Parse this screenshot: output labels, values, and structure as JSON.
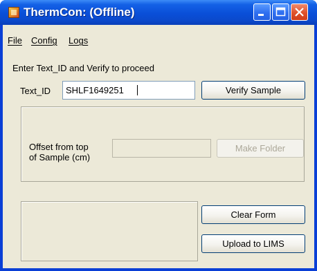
{
  "window": {
    "title": "ThermCon: (Offline)"
  },
  "menu": {
    "file": "File",
    "config": "Config",
    "logs": "Logs"
  },
  "form": {
    "instruction": "Enter Text_ID and Verify to proceed",
    "text_id_label": "Text_ID",
    "text_id_value": "SHLF1649251",
    "verify_button": "Verify Sample",
    "offset_label_line1": "Offset from top",
    "offset_label_line2": "of Sample (cm)",
    "offset_value": "",
    "make_folder_button": "Make Folder",
    "status_box_text": "",
    "clear_button": "Clear Form",
    "upload_button": "Upload to LIMS"
  },
  "icons": {
    "app": "thermcon-app-icon",
    "minimize": "minimize-icon",
    "maximize": "maximize-icon",
    "close": "close-icon"
  },
  "colors": {
    "titlebar": "#0a4fd8",
    "window_bg": "#ece9d8",
    "close_button": "#e0512b"
  }
}
